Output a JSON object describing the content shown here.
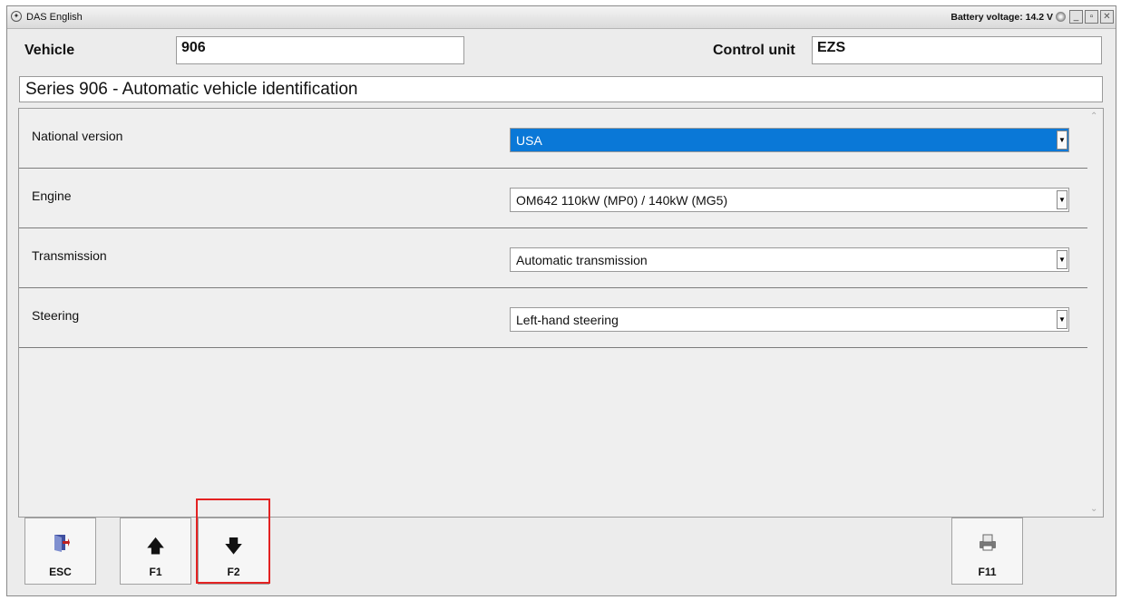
{
  "window": {
    "title": "DAS English",
    "battery_voltage": "Battery voltage: 14.2 V"
  },
  "header": {
    "vehicle_label": "Vehicle",
    "vehicle_value": "906",
    "control_unit_label": "Control unit",
    "control_unit_value": "EZS"
  },
  "series_title": "Series 906 - Automatic vehicle identification",
  "rows": [
    {
      "label": "National version",
      "value": "USA",
      "selected": true
    },
    {
      "label": "Engine",
      "value": "OM642 110kW (MP0) / 140kW (MG5)"
    },
    {
      "label": "Transmission",
      "value": "Automatic transmission"
    },
    {
      "label": "Steering",
      "value": "Left-hand steering"
    }
  ],
  "function_keys": [
    {
      "label": "ESC",
      "icon": "exit-door-icon"
    },
    {
      "label": "F1",
      "icon": "arrow-up-icon"
    },
    {
      "label": "F2",
      "icon": "arrow-down-icon",
      "highlighted": true
    },
    {
      "label": "F11",
      "icon": "printer-icon"
    }
  ],
  "colors": {
    "selection": "#0a78d7",
    "highlight": "#e32222"
  }
}
